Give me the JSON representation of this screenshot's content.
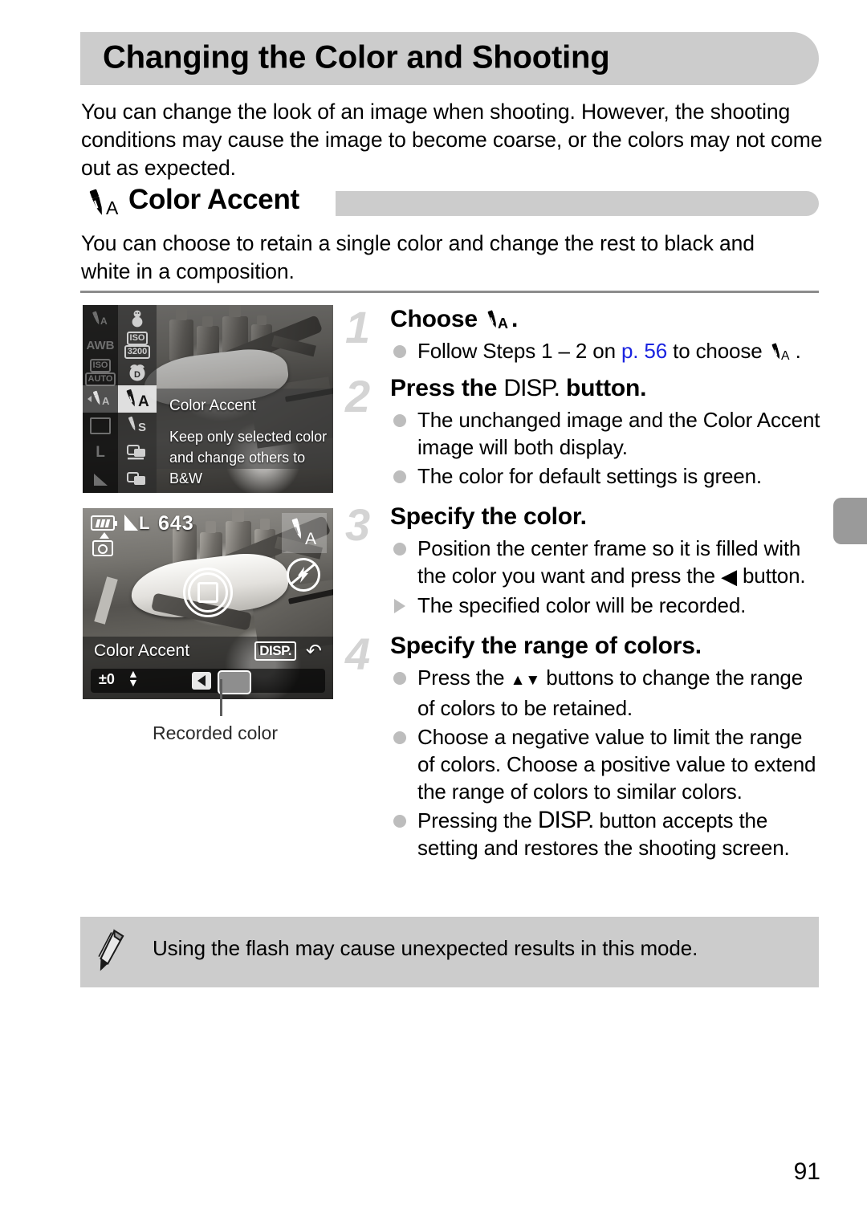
{
  "page": {
    "title": "Changing the Color and Shooting",
    "intro": "You can change the look of an image when shooting. However, the shooting conditions may cause the image to become coarse, or the colors may not come out as expected.",
    "page_number": "91"
  },
  "section": {
    "icon": "color-accent-icon",
    "title": "Color Accent",
    "body": "You can choose to retain a single color and change the rest to black and white in a composition."
  },
  "screenshots": {
    "menu": {
      "selected_label": "Color Accent",
      "description_line1": "Keep only selected color",
      "description_line2": "and change others to B&W",
      "left_column": [
        "WB-A",
        "AWB",
        "ISO AUTO",
        "accent-A",
        "single-frame",
        "L",
        "gradient"
      ],
      "right_column": [
        "snowman",
        "ISO 3200",
        "D",
        "accent-A",
        "accent-S",
        "continuous",
        "continuous-af"
      ],
      "iso_auto_top": "ISO",
      "iso_auto_bottom": "AUTO",
      "iso_3200_top": "ISO",
      "iso_3200_bottom": "3200",
      "awb_label": "AWB",
      "wb_label": "A",
      "l_label": "L",
      "accent_a_label": "A",
      "accent_s_label": "S",
      "d_label": "D"
    },
    "liveview": {
      "battery": "battery-full-icon",
      "quality": "L",
      "shots_remaining": "643",
      "camera_icon": "camera-shake-icon",
      "mode_badge": "color-accent-mode-icon",
      "mode_badge_label": "A",
      "flash_icon": "flash-off-icon",
      "focus_frame": "center-focus-frame",
      "panel_label": "Color Accent",
      "disp_chip": "DISP.",
      "return_arrow": "return-arrow-icon",
      "ev_value": "±0",
      "ev_updown": "updown-arrows-icon",
      "left_button_chip": "left-button-icon",
      "color_swatch": "recorded-color-swatch"
    },
    "caption": "Recorded color"
  },
  "steps": [
    {
      "number": "1",
      "head_prefix": "Choose ",
      "head_icon": "color-accent-icon",
      "head_suffix": ".",
      "bullets": [
        {
          "type": "dot",
          "parts": [
            {
              "kind": "text",
              "value": "Follow Steps 1 – 2 on "
            },
            {
              "kind": "link",
              "value": "p. 56"
            },
            {
              "kind": "text",
              "value": " to choose "
            },
            {
              "kind": "icon",
              "value": "color-accent-icon"
            },
            {
              "kind": "text",
              "value": "."
            }
          ]
        }
      ]
    },
    {
      "number": "2",
      "head_prefix": "Press the ",
      "head_icon": "disp-button-icon",
      "head_icon_text": "DISP.",
      "head_suffix": " button.",
      "bullets": [
        {
          "type": "dot",
          "parts": [
            {
              "kind": "text",
              "value": "The unchanged image and the Color Accent image will both display."
            }
          ]
        },
        {
          "type": "dot",
          "parts": [
            {
              "kind": "text",
              "value": "The color for default settings is green."
            }
          ]
        }
      ]
    },
    {
      "number": "3",
      "head_prefix": "Specify the color.",
      "head_icon": "",
      "head_suffix": "",
      "bullets": [
        {
          "type": "dot",
          "parts": [
            {
              "kind": "text",
              "value": "Position the center frame so it is filled with the color you want and press the "
            },
            {
              "kind": "glyph",
              "value": "◀"
            },
            {
              "kind": "text",
              "value": " button."
            }
          ]
        },
        {
          "type": "triangle",
          "parts": [
            {
              "kind": "text",
              "value": "The specified color will be recorded."
            }
          ]
        }
      ]
    },
    {
      "number": "4",
      "head_prefix": "Specify the range of colors.",
      "head_icon": "",
      "head_suffix": "",
      "bullets": [
        {
          "type": "dot",
          "parts": [
            {
              "kind": "text",
              "value": "Press the "
            },
            {
              "kind": "glyph",
              "value": "▲▼"
            },
            {
              "kind": "text",
              "value": " buttons to change the range of colors to be retained."
            }
          ]
        },
        {
          "type": "dot",
          "parts": [
            {
              "kind": "text",
              "value": "Choose a negative value to limit the range of colors. Choose a positive value to extend the range of colors to similar colors."
            }
          ]
        },
        {
          "type": "dot",
          "parts": [
            {
              "kind": "text",
              "value": "Pressing the "
            },
            {
              "kind": "dispword",
              "value": "DISP."
            },
            {
              "kind": "text",
              "value": " button accepts the setting and restores the shooting screen."
            }
          ]
        }
      ]
    }
  ],
  "note": {
    "icon": "pencil-icon",
    "text": "Using the flash may cause unexpected results in this mode."
  },
  "colors": {
    "banner_gray": "#cccccc",
    "link_blue": "#1a23e0",
    "step_number_gray": "#d4d4d4",
    "bullet_gray": "#bdbdbd",
    "rule_gray": "#8c8c8c",
    "tab_gray": "#9a9a9a"
  }
}
